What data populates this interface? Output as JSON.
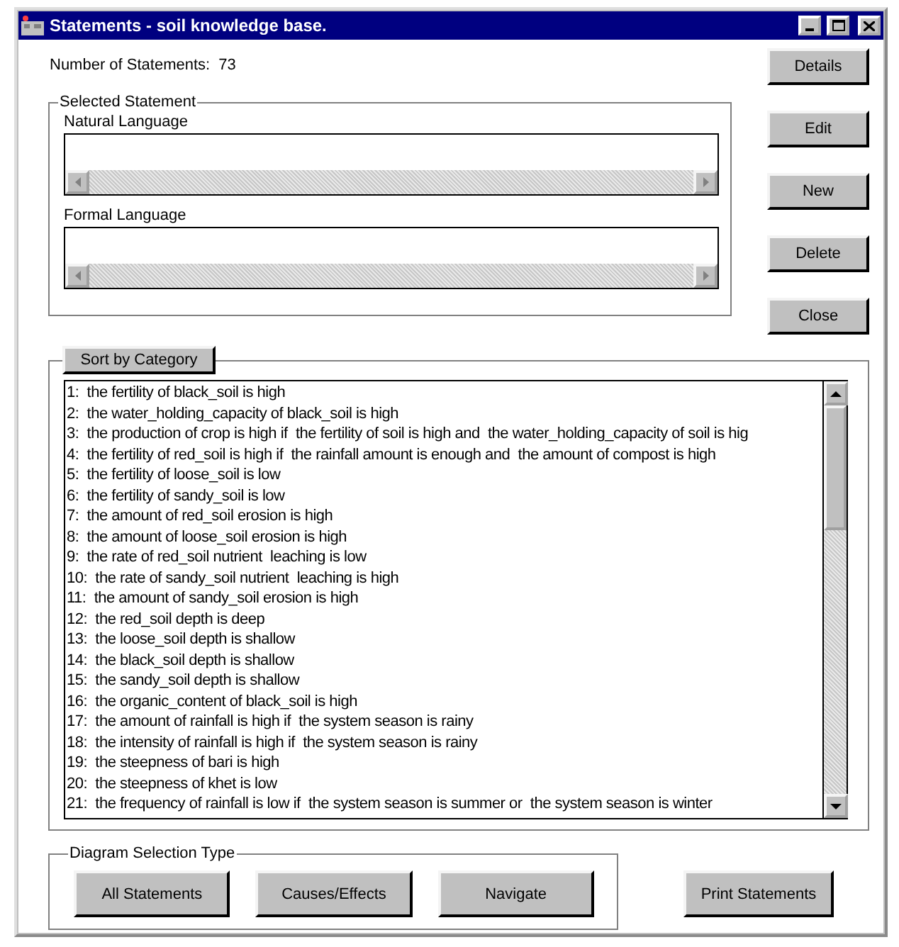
{
  "window": {
    "title": "Statements - soil knowledge base."
  },
  "count": {
    "label": "Number of Statements:",
    "value": "73"
  },
  "side_buttons": [
    "Details",
    "Edit",
    "New",
    "Delete",
    "Close"
  ],
  "selected_statement": {
    "title": "Selected Statement",
    "fields": [
      {
        "label": "Natural Language"
      },
      {
        "label": "Formal Language"
      }
    ]
  },
  "sort_button": "Sort by Category",
  "statements": [
    "1:  the fertility of black_soil is high",
    "2:  the water_holding_capacity of black_soil is high",
    "3:  the production of crop is high if  the fertility of soil is high and  the water_holding_capacity of soil is hig",
    "4:  the fertility of red_soil is high if  the rainfall amount is enough and  the amount of compost is high",
    "5:  the fertility of loose_soil is low",
    "6:  the fertility of sandy_soil is low",
    "7:  the amount of red_soil erosion is high",
    "8:  the amount of loose_soil erosion is high",
    "9:  the rate of red_soil nutrient  leaching is low",
    "10:  the rate of sandy_soil nutrient  leaching is high",
    "11:  the amount of sandy_soil erosion is high",
    "12:  the red_soil depth is deep",
    "13:  the loose_soil depth is shallow",
    "14:  the black_soil depth is shallow",
    "15:  the sandy_soil depth is shallow",
    "16:  the organic_content of black_soil is high",
    "17:  the amount of rainfall is high if  the system season is rainy",
    "18:  the intensity of rainfall is high if  the system season is rainy",
    "19:  the steepness of bari is high",
    "20:  the steepness of khet is low",
    "21:  the frequency of rainfall is low if  the system season is summer or  the system season is winter"
  ],
  "diagram_selection": {
    "title": "Diagram Selection Type",
    "buttons": [
      "All Statements",
      "Causes/Effects",
      "Navigate"
    ]
  },
  "print_button": "Print Statements"
}
